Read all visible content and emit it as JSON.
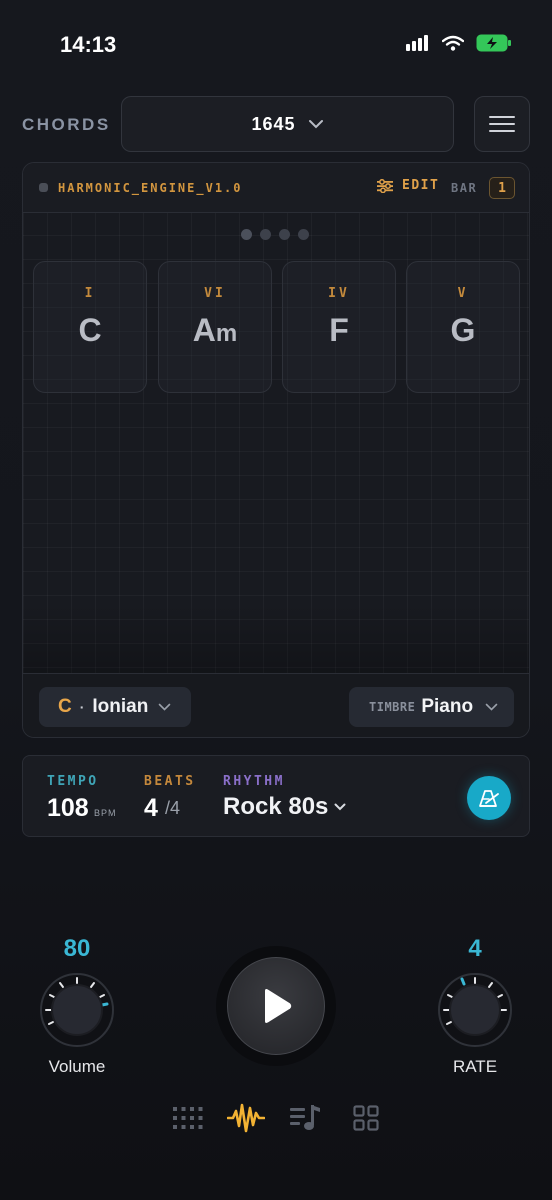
{
  "status": {
    "time": "14:13"
  },
  "header": {
    "chords_label": "CHORDS",
    "preset": "1645"
  },
  "engine": {
    "name": "HARMONIC_ENGINE_V1.0",
    "edit_label": "EDIT",
    "bar_label": "BAR",
    "bar_value": "1",
    "chords": [
      {
        "degree": "I",
        "root": "C",
        "quality": ""
      },
      {
        "degree": "VI",
        "root": "A",
        "quality": "m"
      },
      {
        "degree": "IV",
        "root": "F",
        "quality": ""
      },
      {
        "degree": "V",
        "root": "G",
        "quality": ""
      }
    ],
    "key": {
      "root": "C",
      "separator": "·",
      "mode": "Ionian"
    },
    "timbre": {
      "label": "TIMBRE",
      "value": "Piano"
    }
  },
  "transport": {
    "tempo_label": "TEMPO",
    "tempo_value": "108",
    "tempo_unit": "BPM",
    "beats_label": "BEATS",
    "beats_numerator": "4",
    "beats_denominator": "/4",
    "rhythm_label": "RHYTHM",
    "rhythm_value": "Rock 80s"
  },
  "knobs": {
    "volume": {
      "value": "80",
      "label": "Volume",
      "level": 0.8
    },
    "rate": {
      "value": "4",
      "label": "RATE"
    }
  },
  "colors": {
    "accent_amber": "#e0a14a",
    "accent_cyan": "#18a9c8",
    "accent_purple": "#8a6fc9"
  },
  "nav": {
    "items": [
      {
        "icon": "grid-dots-icon"
      },
      {
        "icon": "waveform-icon",
        "active": true
      },
      {
        "icon": "playlist-music-icon"
      },
      {
        "icon": "apps-grid-icon"
      }
    ]
  }
}
